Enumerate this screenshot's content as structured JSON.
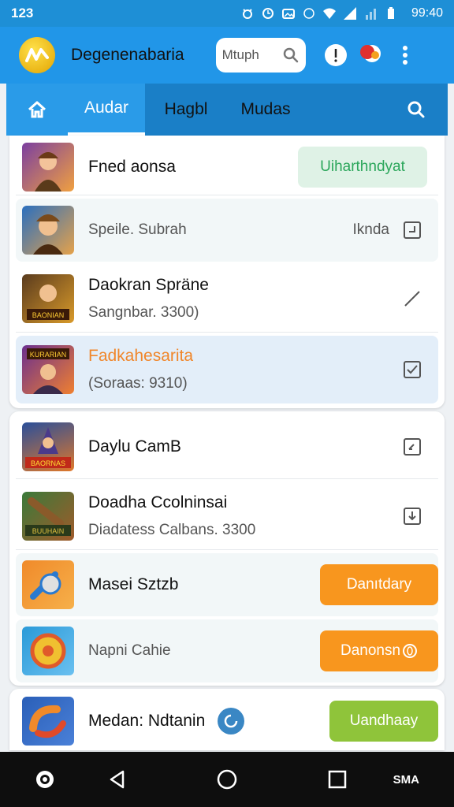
{
  "status_bar": {
    "time_left": "123",
    "clock": "99:40"
  },
  "app_bar": {
    "title": "Degenenabaria",
    "search_placeholder": "Mtuph"
  },
  "tabs": {
    "active": "Audar",
    "tab2": "Hagbl",
    "tab3": "Mudas"
  },
  "list1": [
    {
      "title": "Fned aonsa",
      "action": "Uiharthndyat",
      "thumb_colors": [
        "#7b3fa0",
        "#f0a040"
      ]
    },
    {
      "title": "Speile. Subrah",
      "right_label": "Iknda",
      "icon": "square-check-icon",
      "thumb_colors": [
        "#2a6fbf",
        "#e6a24a"
      ]
    },
    {
      "title": "Daokran Spräne",
      "subtitle": "Sangnbar. 3300)",
      "icon": "edit-pen-icon",
      "thumb_colors": [
        "#5a3b1e",
        "#d99a2a"
      ],
      "thumb_text": "BAONIAN"
    },
    {
      "title": "Fadkahesarita",
      "subtitle": "(Soraas: 9310)",
      "icon": "check-box-icon",
      "thumb_colors": [
        "#6a2f8f",
        "#f08030"
      ],
      "thumb_text": "KURARIAN"
    }
  ],
  "list2": [
    {
      "title": "Daylu CamB",
      "icon": "download-box-icon",
      "thumb_colors": [
        "#2a4f9a",
        "#e0782a"
      ],
      "thumb_text": "BAORNAS"
    },
    {
      "title": "Doadha Ccolninsai",
      "subtitle": "Diadatess Calbans. 3300",
      "icon": "download-arrow-icon",
      "thumb_colors": [
        "#3a7a3a",
        "#a05a2a"
      ],
      "thumb_text": "BUUHAIN"
    },
    {
      "title": "Masei Sztzb",
      "action": "Danıtdary",
      "thumb_colors": [
        "#f08a2a",
        "#2a7ad0"
      ]
    },
    {
      "title": "Napni Cahie",
      "action": "Danonsn",
      "action_icon": "circle-zero-icon",
      "thumb_colors": [
        "#2a9ad8",
        "#f0c030"
      ]
    }
  ],
  "list3": [
    {
      "title": "Medan: Ndtanin",
      "icon": "info-icon",
      "action": "Uandhaay",
      "thumb_colors": [
        "#2a5fb8",
        "#f08a2a"
      ]
    }
  ],
  "nav_bar": {
    "label": "SMA"
  },
  "colors": {
    "primary": "#2196e8",
    "tab_bg": "#1a7fc7",
    "orange": "#f8961e",
    "lime": "#8fc43a",
    "mint_text": "#2aa65a"
  }
}
